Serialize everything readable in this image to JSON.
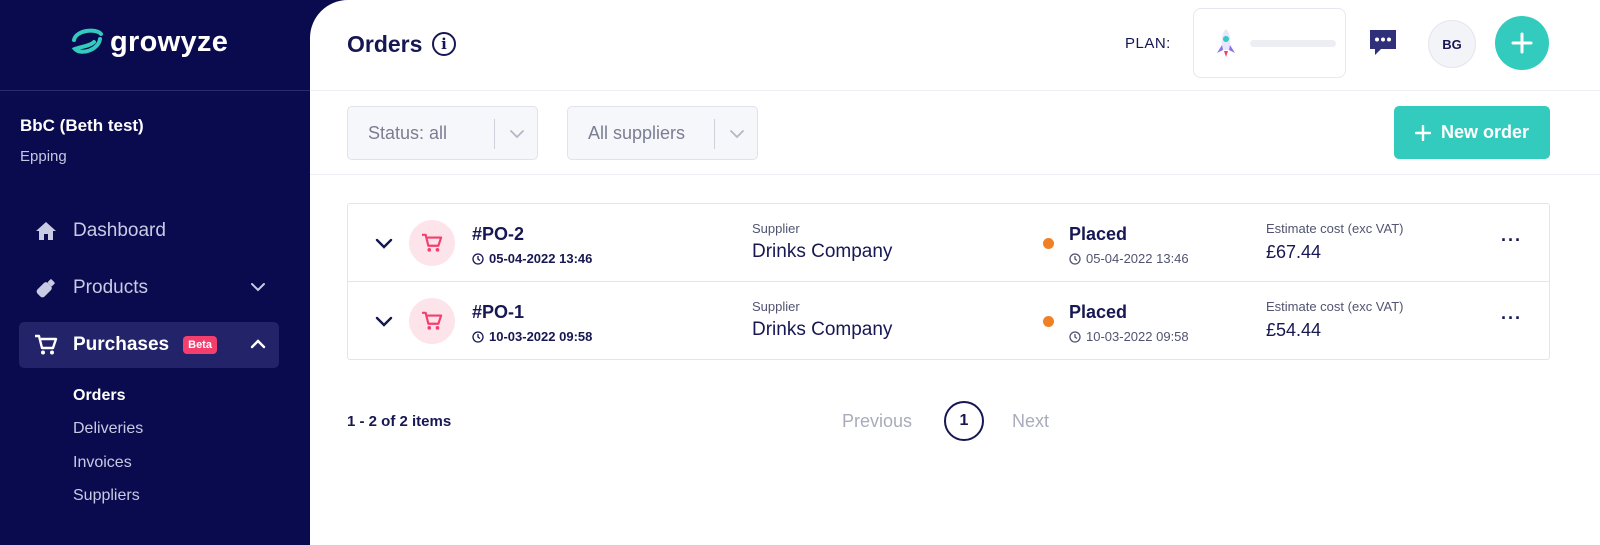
{
  "brand": {
    "name": "growyze",
    "icon": "growyze-logo-icon"
  },
  "account": {
    "name": "BbC (Beth test)",
    "location": "Epping"
  },
  "nav": {
    "items": [
      {
        "label": "Dashboard",
        "icon": "home-icon"
      },
      {
        "label": "Products",
        "icon": "bottle-icon"
      },
      {
        "label": "Purchases",
        "icon": "cart-icon",
        "badge": "Beta"
      }
    ],
    "subitems": [
      "Orders",
      "Deliveries",
      "Invoices",
      "Suppliers"
    ]
  },
  "header": {
    "title": "Orders",
    "plan_label": "PLAN:",
    "avatar_initials": "BG"
  },
  "filters": {
    "status": "Status: all",
    "supplier": "All suppliers"
  },
  "actions": {
    "new_order": "New order"
  },
  "orders": [
    {
      "id": "#PO-2",
      "created": "05-04-2022 13:46",
      "supplier_label": "Supplier",
      "supplier": "Drinks Company",
      "status": "Placed",
      "status_date": "05-04-2022 13:46",
      "cost_label": "Estimate cost (exc VAT)",
      "cost": "£67.44",
      "more": "···"
    },
    {
      "id": "#PO-1",
      "created": "10-03-2022 09:58",
      "supplier_label": "Supplier",
      "supplier": "Drinks Company",
      "status": "Placed",
      "status_date": "10-03-2022 09:58",
      "cost_label": "Estimate cost (exc VAT)",
      "cost": "£54.44",
      "more": "···"
    }
  ],
  "pagination": {
    "summary": "1 - 2 of 2 items",
    "previous": "Previous",
    "page": "1",
    "next": "Next"
  },
  "colors": {
    "sidebar": "#0a0a4f",
    "accent": "#33cbbd",
    "status_placed": "#f08026",
    "beta": "#f43f6e"
  }
}
